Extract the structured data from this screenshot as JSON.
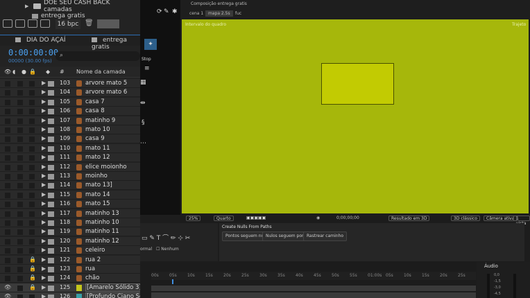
{
  "project": {
    "rows": [
      {
        "name": "DOE SEU CASH BACK camadas",
        "type": "folder"
      },
      {
        "name": "entrega gratis",
        "type": "comp"
      }
    ],
    "bpc": "16 bpc"
  },
  "tabs": [
    "DIA DO AÇAÍ",
    "entrega gratis"
  ],
  "timecode": "0:00:00:00",
  "fps": "00000 (30.00 fps)",
  "search": {
    "glyph": "⌕",
    "placeholder": ""
  },
  "columns": {
    "number": "#",
    "name": "Nome da camada"
  },
  "layers": [
    {
      "num": "103",
      "name": "arvore mato 5",
      "lock": false,
      "eye": false,
      "icon": "ai"
    },
    {
      "num": "104",
      "name": "arvore mato 6",
      "lock": false,
      "eye": false,
      "icon": "ai"
    },
    {
      "num": "105",
      "name": "casa 7",
      "lock": false,
      "eye": false,
      "icon": "ai"
    },
    {
      "num": "106",
      "name": "casa 8",
      "lock": false,
      "eye": false,
      "icon": "ai"
    },
    {
      "num": "107",
      "name": "matinho 9",
      "lock": false,
      "eye": false,
      "icon": "ai"
    },
    {
      "num": "108",
      "name": "mato 10",
      "lock": false,
      "eye": false,
      "icon": "ai"
    },
    {
      "num": "109",
      "name": "casa 9",
      "lock": false,
      "eye": false,
      "icon": "ai"
    },
    {
      "num": "110",
      "name": "mato 11",
      "lock": false,
      "eye": false,
      "icon": "ai"
    },
    {
      "num": "111",
      "name": "mato 12",
      "lock": false,
      "eye": false,
      "icon": "ai"
    },
    {
      "num": "112",
      "name": "elice moionho",
      "lock": false,
      "eye": false,
      "icon": "ai"
    },
    {
      "num": "113",
      "name": "moinho",
      "lock": false,
      "eye": false,
      "icon": "ai"
    },
    {
      "num": "114",
      "name": "mato 13]",
      "lock": false,
      "eye": false,
      "icon": "ai"
    },
    {
      "num": "115",
      "name": "mato 14",
      "lock": false,
      "eye": false,
      "icon": "ai"
    },
    {
      "num": "116",
      "name": "mato 15",
      "lock": false,
      "eye": false,
      "icon": "ai"
    },
    {
      "num": "117",
      "name": "matinho 13",
      "lock": false,
      "eye": false,
      "icon": "ai"
    },
    {
      "num": "118",
      "name": "matinho 10",
      "lock": false,
      "eye": false,
      "icon": "ai"
    },
    {
      "num": "119",
      "name": "matinho 11",
      "lock": false,
      "eye": false,
      "icon": "ai"
    },
    {
      "num": "120",
      "name": "matinho 12",
      "lock": false,
      "eye": false,
      "icon": "ai"
    },
    {
      "num": "121",
      "name": "celeiro",
      "lock": false,
      "eye": false,
      "icon": "ai"
    },
    {
      "num": "122",
      "name": "rua 2",
      "lock": true,
      "eye": false,
      "icon": "ai"
    },
    {
      "num": "123",
      "name": "rua",
      "lock": true,
      "eye": false,
      "icon": "ai"
    },
    {
      "num": "124",
      "name": "chão",
      "lock": true,
      "eye": false,
      "icon": "ai"
    },
    {
      "num": "125",
      "name": "[Amarelo Sólido 3]",
      "lock": true,
      "eye": true,
      "icon": "solid"
    },
    {
      "num": "126",
      "name": "[Profundo Ciano Sóli",
      "lock": false,
      "eye": true,
      "icon": "solid2"
    }
  ],
  "middle": {
    "label_stop": "Stop"
  },
  "composition": {
    "title": "Composição entrega gratis",
    "tabs": [
      "cena 1",
      "mapa 2.5s",
      "fuc"
    ],
    "info_left": "Intervalo do quadro",
    "info_right": "Trajeto",
    "zoom": "25%",
    "quality": "Quarto",
    "timecode": "0;00;00;00",
    "render_label": "Resultado em 3D",
    "view3d": "3D clássico",
    "camera": "Câmera ativa",
    "views": "1 vista"
  },
  "nulls": {
    "title": "Create Nulls From Paths",
    "buttons": [
      "Pontos seguem nulos",
      "Nulos seguem pontos",
      "Rastrear caminho"
    ]
  },
  "bottom_mid": {
    "normal_label": "ormal",
    "none_label": "Nenhum"
  },
  "ruler_ticks": [
    "00s",
    "05s",
    "10s",
    "15s",
    "20s",
    "25s",
    "30s",
    "35s",
    "40s",
    "45s",
    "50s",
    "55s",
    "01:00s",
    "05s",
    "10s",
    "15s",
    "20s",
    "25s"
  ],
  "audio": {
    "title": "Áudio",
    "marks": [
      "0,0",
      "-1,5",
      "-3,0",
      "-4,5"
    ]
  },
  "colors": {
    "viewer_bg": "#a6b70b",
    "solid": "#c2cb02",
    "accent": "#4aa0f0"
  }
}
